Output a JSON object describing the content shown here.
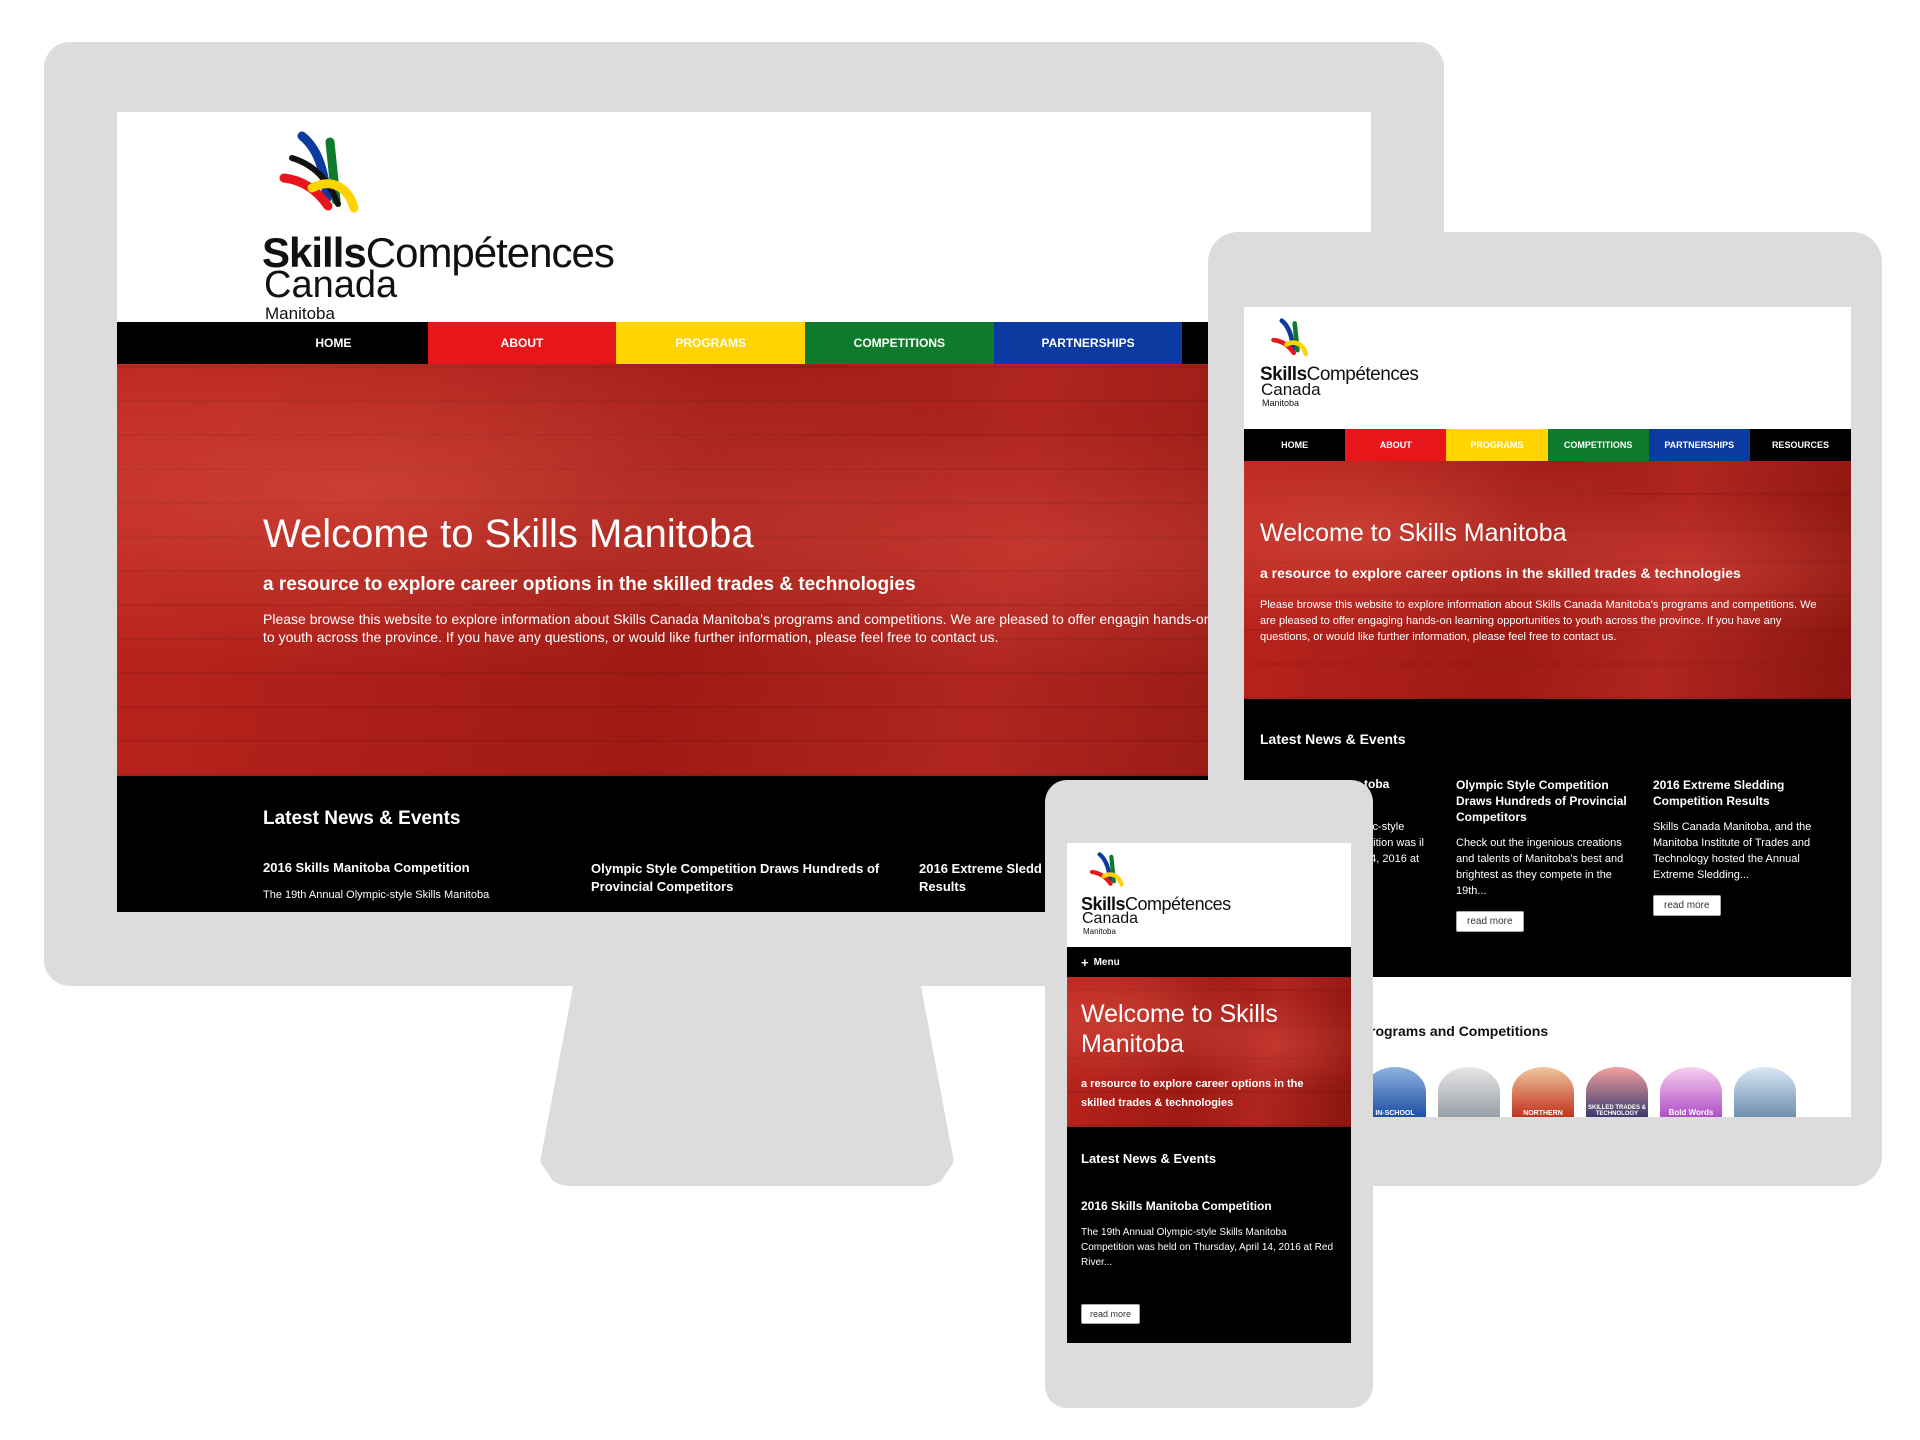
{
  "brand": {
    "name_bold": "Skills",
    "name_light": "Compétences",
    "line2": "Canada",
    "line3": "Manitoba"
  },
  "nav": [
    {
      "label": "HOME",
      "color": "#000000"
    },
    {
      "label": "ABOUT",
      "color": "#e8151b"
    },
    {
      "label": "PROGRAMS",
      "color": "#ffd400"
    },
    {
      "label": "COMPETITIONS",
      "color": "#0f7a2b"
    },
    {
      "label": "PARTNERSHIPS",
      "color": "#0b3aa0"
    },
    {
      "label": "RESOURCES",
      "color": "#000000"
    }
  ],
  "hero": {
    "title": "Welcome to Skills Manitoba",
    "subtitle": "a resource to explore career options in the skilled trades & technologies",
    "body": "Please browse this website to explore information about Skills Canada Manitoba's programs and competitions. We are pleased to offer engaging hands-on learning opportunities to youth across the province. If you have any questions, or would like further information, please feel free to contact us.",
    "desktop_body": "Please browse this website to explore information about Skills Canada Manitoba's programs and competitions. We are pleased to offer engagin hands-on learning opportunities to youth across the province. If you have any questions, or would like further information, please feel free to contact us.",
    "mobile_title": "Welcome to Skills Manitoba"
  },
  "news": {
    "heading": "Latest News & Events",
    "items": [
      {
        "title": "2016 Skills Manitoba Competition",
        "excerpt": "The 19th Annual Olympic-style Skills Manitoba Competition was held on Thursday, April 14, 2016 at Red River..."
      },
      {
        "title": "Olympic Style Competition Draws Hundreds of Provincial Competitors",
        "excerpt": "Check out the ingenious creations and talents of Manitoba's best and brightest as they compete in the 19th..."
      },
      {
        "title": "2016 Extreme Sledding Competition Results",
        "excerpt": "Skills Canada Manitoba, and the Manitoba Institute of Trades and Technology hosted the Annual Extreme Sledding..."
      }
    ],
    "read_more": "read more",
    "desktop_col3_title": "2016 Extreme Sledd Results",
    "desktop_col1_excerpt": "The 19th Annual Olympic-style Skills Manitoba",
    "tablet_col1_title": "toba",
    "tablet_col1_excerpt": "pic-style etition was il 14, 2016 at"
  },
  "programs": {
    "heading": "rograms and Competitions",
    "badges": [
      "IN-SCHOOL",
      "NORTHERN",
      "SKILLED TRADES & TECHNOLOGY",
      "Bold Words"
    ]
  },
  "mobile": {
    "menu_label": "Menu"
  },
  "colors": {
    "frame": "#dcdcdc",
    "hero_red": "#b0221b",
    "news_bg": "#000000"
  }
}
